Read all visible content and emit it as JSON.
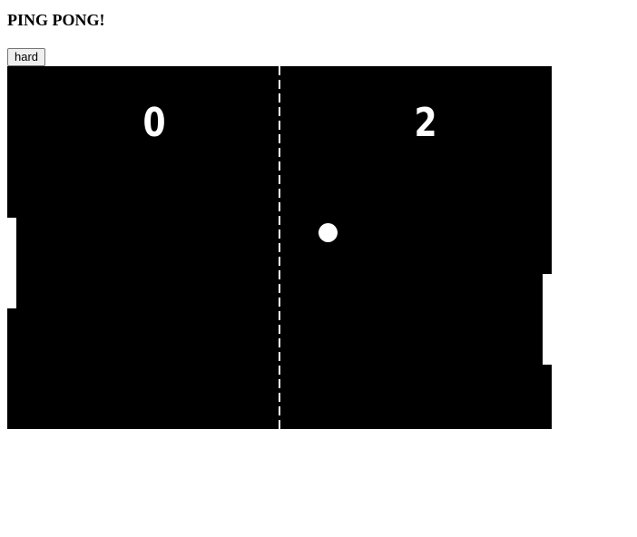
{
  "page": {
    "title": "PING PONG!"
  },
  "controls": {
    "difficulty_label": "hard"
  },
  "game": {
    "score_left": "0",
    "score_right": "2"
  },
  "colors": {
    "court": "#000000",
    "foreground": "#ffffff"
  }
}
